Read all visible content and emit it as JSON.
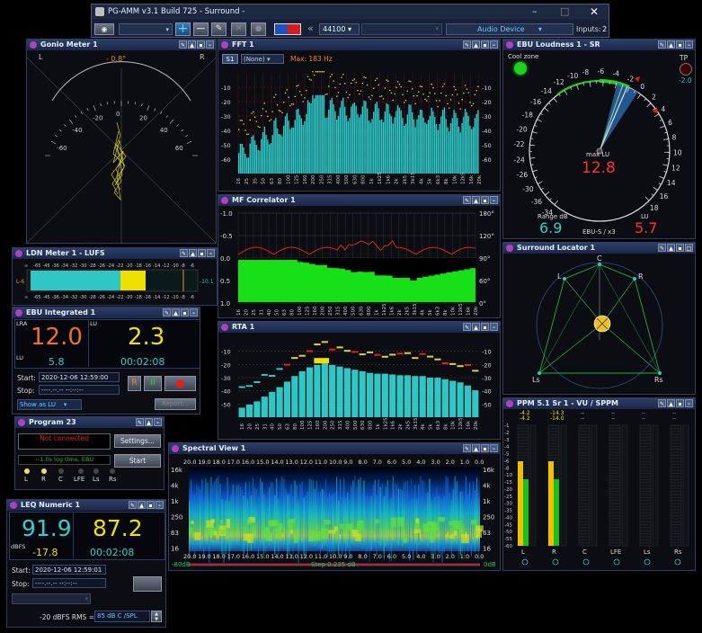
{
  "main_toolbar": {
    "title": "PG-AMM v3.1 Build 725 - Surround -",
    "sample_rate": "44100",
    "device": "Audio Device",
    "inputs_label": "Inputs:",
    "inputs_value": "2",
    "window_controls": [
      "–",
      "□",
      "✕"
    ]
  },
  "goniometer": {
    "title": "Gonio Meter 1",
    "left": "L",
    "right": "R",
    "phase": "- 0.8°",
    "scale": [
      "-60",
      "-40",
      "-20",
      "0",
      "20",
      "40",
      "60"
    ]
  },
  "fft": {
    "title": "FFT 1",
    "channel": "S1",
    "preset": "(None)",
    "max_label": "Max: 183 Hz",
    "y_ticks": [
      "-10",
      "-20",
      "-30",
      "-40",
      "-50",
      "-60"
    ],
    "x_ticks": [
      "16",
      "25",
      "35",
      "50",
      "63",
      "80",
      "100",
      "125",
      "160",
      "200",
      "250",
      "315",
      "400",
      "500",
      "630",
      "800",
      "1k",
      "1k25",
      "1k6",
      "2k",
      "2k5",
      "3k15",
      "4k",
      "5k",
      "6k3",
      "8k",
      "10k",
      "12k5",
      "16k",
      "20k"
    ]
  },
  "ebu_loudness": {
    "title": "EBU Loudness 1 - SR",
    "cool_zone": "Cool zone",
    "tp_label": "TP",
    "tp_value": "-2.0",
    "max_lu_label": "max LU",
    "max_lu_value": "12.8",
    "range_label": "Range dB",
    "range_value": "6.9",
    "lu_label": "LU",
    "lu_value": "5.7",
    "mode": "EBU-S / x3",
    "scale": [
      "-34",
      "-36",
      "-30",
      "-26",
      "-24",
      "-22",
      "-20",
      "-18",
      "-16",
      "-14",
      "-12",
      "-10",
      "-8",
      "-6",
      "-4",
      "-2",
      "0",
      "2",
      "4",
      "6",
      "8",
      "10",
      "12",
      "14",
      "16",
      "18"
    ]
  },
  "correlator": {
    "title": "MF Correlator 1",
    "y_left": [
      "-1.0",
      "-0.5",
      "0.0",
      "0.5",
      "1.0"
    ],
    "y_right": [
      "180°",
      "120°",
      "90°",
      "60°",
      "0°"
    ]
  },
  "ldn": {
    "title": "LDN Meter 1 - LUFS",
    "channel": "L-6",
    "value": "-10.1",
    "scale": [
      "∞",
      "-65",
      "-45",
      "-36",
      "-34",
      "-32",
      "-30",
      "-28",
      "-26",
      "-24",
      "-22",
      "-20",
      "-18",
      "-16",
      "-14",
      "-12",
      "-10",
      "-8",
      "-6"
    ]
  },
  "surround": {
    "title": "Surround Locator 1",
    "labels": [
      "C",
      "L",
      "R",
      "Ls",
      "Rs"
    ]
  },
  "ebu_int": {
    "title": "EBU Integrated 1",
    "lra_label": "LRA",
    "lu_label_top": "LU",
    "lra_value": "12.0",
    "lu_value": "2.3",
    "lu_label": "LU",
    "lu_small": "5.8",
    "time": "00:02:08",
    "start_label": "Start:",
    "start_value": "2020-12-06 12:59:00",
    "stop_label": "Stop:",
    "stop_value": "----.--.-- --:--:--",
    "show_as": "Show as LU",
    "report": "Report...",
    "btn_r": "R",
    "btn_pause": "II"
  },
  "rta": {
    "title": "RTA 1",
    "y_ticks": [
      "-10",
      "-20",
      "-30",
      "-40",
      "-50"
    ],
    "x_ticks": [
      "16",
      "20",
      "25",
      "31",
      "40",
      "50",
      "63",
      "80",
      "100",
      "125",
      "160",
      "200",
      "250",
      "315",
      "400",
      "500",
      "630",
      "800",
      "1k",
      "1k25",
      "1k6",
      "2k",
      "2k5",
      "3k15",
      "4k",
      "5k",
      "6k3",
      "8k",
      "10k",
      "12k5",
      "16k",
      "20k"
    ]
  },
  "program": {
    "title": "Program 23",
    "status": "Not connected",
    "settings": "Settings...",
    "log_time": "~1.0s log time, EBU",
    "start": "Start",
    "channels": [
      "L",
      "R",
      "C",
      "LFE",
      "Ls",
      "Rs"
    ]
  },
  "spectral": {
    "title": "Spectral View 1",
    "y_left": [
      "16k",
      "4k",
      "1k",
      "250",
      "63",
      "16"
    ],
    "y_right": [
      "16k",
      "4k",
      "1k",
      "250",
      "63",
      "16"
    ],
    "time_ticks": [
      "20.0",
      "19.0",
      "18.0",
      "17.0",
      "16.0",
      "15.0",
      "14.0",
      "13.0",
      "12.0",
      "11.0",
      "10.0",
      "9.0",
      "8.0",
      "7.0",
      "6.0",
      "5.0",
      "4.0",
      "3.0",
      "2.0",
      "1.0",
      "0.0"
    ],
    "db_low": "-80dB",
    "step": "Step 0.235 dB",
    "db_high": "0dB"
  },
  "ppm": {
    "title": "PPM 5.1 Sr 1 - VU / SPPM",
    "peak_labels": [
      "-4.2",
      "-4.2",
      "-14.3",
      "-14.0",
      "--",
      "--",
      "--",
      "--",
      "--",
      "--",
      "--",
      "--"
    ],
    "scale": [
      "-1",
      "-2",
      "-3",
      "-4",
      "-5",
      "-6",
      "-8",
      "-10",
      "-15",
      "-20",
      "-25",
      "-30",
      "-35",
      "-40",
      "-45",
      "-50",
      "-55",
      "-60"
    ],
    "channels": [
      "L",
      "R",
      "C",
      "LFE",
      "Ls",
      "Rs"
    ]
  },
  "leq": {
    "title": "LEQ Numeric 1",
    "value1": "91.9",
    "value2": "87.2",
    "unit": "dBFS",
    "value3": "-17.8",
    "time": "00:02:08",
    "start_label": "Start:",
    "start_value": "2020-12-06 12:59:01",
    "stop_label": "Stop:",
    "stop_value": "----.--.-- --:--:--",
    "rms_label": "-20 dBFS RMS =",
    "spl_value": "85 dB C /SPL"
  },
  "colors": {
    "cyan": "#2fc6c6",
    "green": "#18e018",
    "yellow": "#f0e000",
    "red": "#e02020",
    "orange": "#f08020"
  }
}
